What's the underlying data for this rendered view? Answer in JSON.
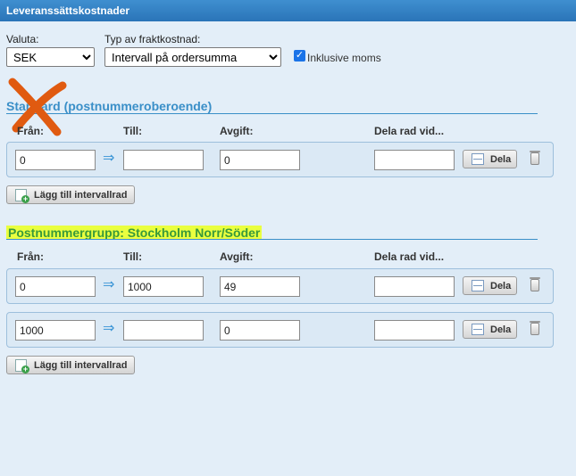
{
  "window": {
    "title": "Leveranssättskostnader"
  },
  "currency": {
    "label": "Valuta:",
    "value": "SEK"
  },
  "freight_type": {
    "label": "Typ av fraktkostnad:",
    "value": "Intervall på ordersumma"
  },
  "vat_checkbox": {
    "label": "Inklusive moms",
    "checked": true
  },
  "column_headers": {
    "from": "Från:",
    "to": "Till:",
    "fee": "Avgift:",
    "split": "Dela rad vid..."
  },
  "split_button_label": "Dela",
  "add_row_label": "Lägg till intervallrad",
  "sections": [
    {
      "title": "Standard (postnummeroberoende)",
      "rows": [
        {
          "from": "0",
          "to": "",
          "fee": "0",
          "split": ""
        }
      ]
    },
    {
      "title": "Postnummergrupp: Stockholm Norr/Söder",
      "rows": [
        {
          "from": "0",
          "to": "1000",
          "fee": "49",
          "split": ""
        },
        {
          "from": "1000",
          "to": "",
          "fee": "0",
          "split": ""
        }
      ]
    }
  ],
  "colors": {
    "accent": "#3a8fc8",
    "titlebar": "#2a74b8",
    "highlight": "#eaff3f",
    "annotation": "#e05a10"
  }
}
